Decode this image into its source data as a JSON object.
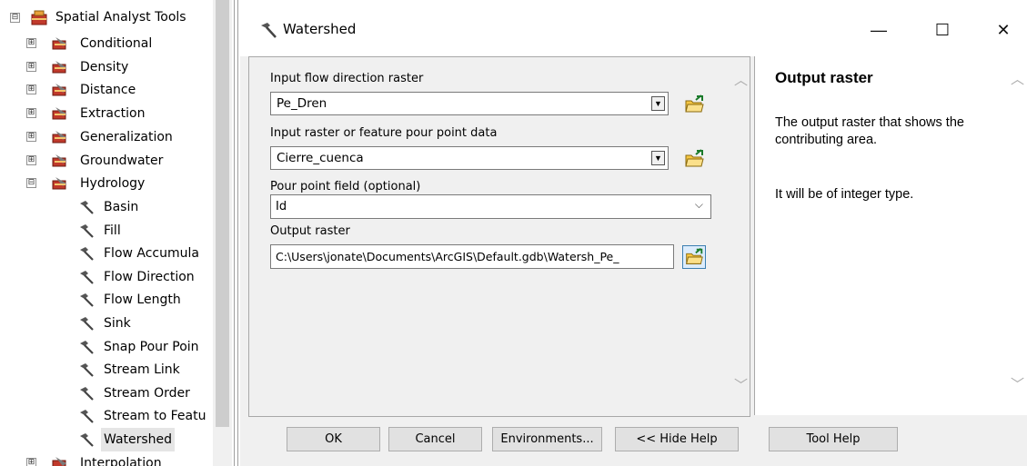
{
  "tree": {
    "root": {
      "label": "Spatial Analyst Tools",
      "expander": "⊟"
    },
    "toolsets": [
      {
        "label": "Conditional",
        "expander": "⊞"
      },
      {
        "label": "Density",
        "expander": "⊞"
      },
      {
        "label": "Distance",
        "expander": "⊞"
      },
      {
        "label": "Extraction",
        "expander": "⊞"
      },
      {
        "label": "Generalization",
        "expander": "⊞"
      },
      {
        "label": "Groundwater",
        "expander": "⊞"
      }
    ],
    "hydrology": {
      "label": "Hydrology",
      "expander": "⊟"
    },
    "tools": [
      {
        "label": "Basin"
      },
      {
        "label": "Fill"
      },
      {
        "label": "Flow Accumula"
      },
      {
        "label": "Flow Direction"
      },
      {
        "label": "Flow Length"
      },
      {
        "label": "Sink"
      },
      {
        "label": "Snap Pour Poin"
      },
      {
        "label": "Stream Link"
      },
      {
        "label": "Stream Order"
      },
      {
        "label": "Stream to Featu"
      },
      {
        "label": "Watershed",
        "selected": true
      }
    ],
    "after": {
      "label": "Interpolation",
      "expander": "⊞"
    }
  },
  "dialog": {
    "title": "Watershed",
    "window_buttons": {
      "minimize": "—",
      "maximize": "☐",
      "close": "✕"
    },
    "params": {
      "flow_dir_label": "Input flow direction raster",
      "flow_dir_value": "Pe_Dren",
      "pour_point_label": "Input raster or feature pour point data",
      "pour_point_value": "Cierre_cuenca",
      "pour_field_label": "Pour point field (optional)",
      "pour_field_value": "Id",
      "output_label": "Output raster",
      "output_value": "C:\\Users\\jonate\\Documents\\ArcGIS\\Default.gdb\\Watersh_Pe_"
    },
    "help": {
      "title": "Output raster",
      "p1": "The output raster that shows the contributing area.",
      "p2": "It will be of integer type."
    },
    "buttons": {
      "ok": "OK",
      "cancel": "Cancel",
      "environments": "Environments...",
      "hide_help": "<< Hide Help",
      "tool_help": "Tool Help"
    }
  }
}
